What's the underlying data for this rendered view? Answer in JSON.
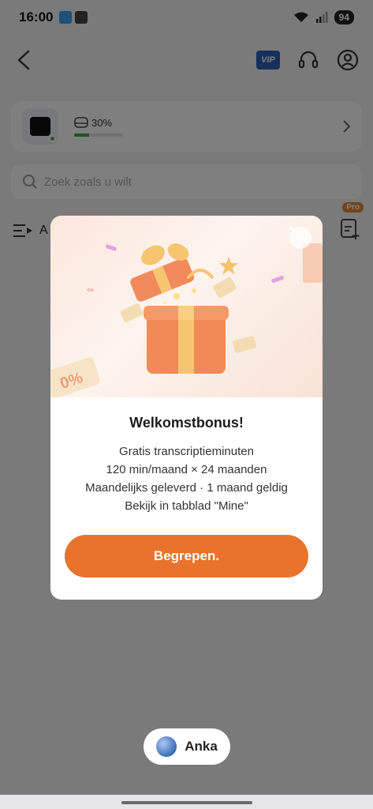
{
  "status_bar": {
    "time": "16:00",
    "battery": "94"
  },
  "nav": {
    "vip_label": "VIP"
  },
  "device": {
    "storage_percent": "30%",
    "storage_fraction": 0.3
  },
  "search": {
    "placeholder": "Zoek zoals u wilt"
  },
  "list": {
    "header_fragment": "A",
    "pro_label": "Pro"
  },
  "modal": {
    "title": "Welkomstbonus!",
    "lines": [
      "Gratis transcriptieminuten",
      "120 min/maand × 24 maanden",
      "Maandelijks geleverd · 1 maand geldig",
      "Bekijk in tabblad \"Mine\""
    ],
    "cta_label": "Begrepen.",
    "image_text": "0%"
  },
  "assistant": {
    "label": "Anka"
  },
  "colors": {
    "accent": "#e9732c",
    "storage_fill": "#3aa84a",
    "vip": "#2e5fb8"
  }
}
